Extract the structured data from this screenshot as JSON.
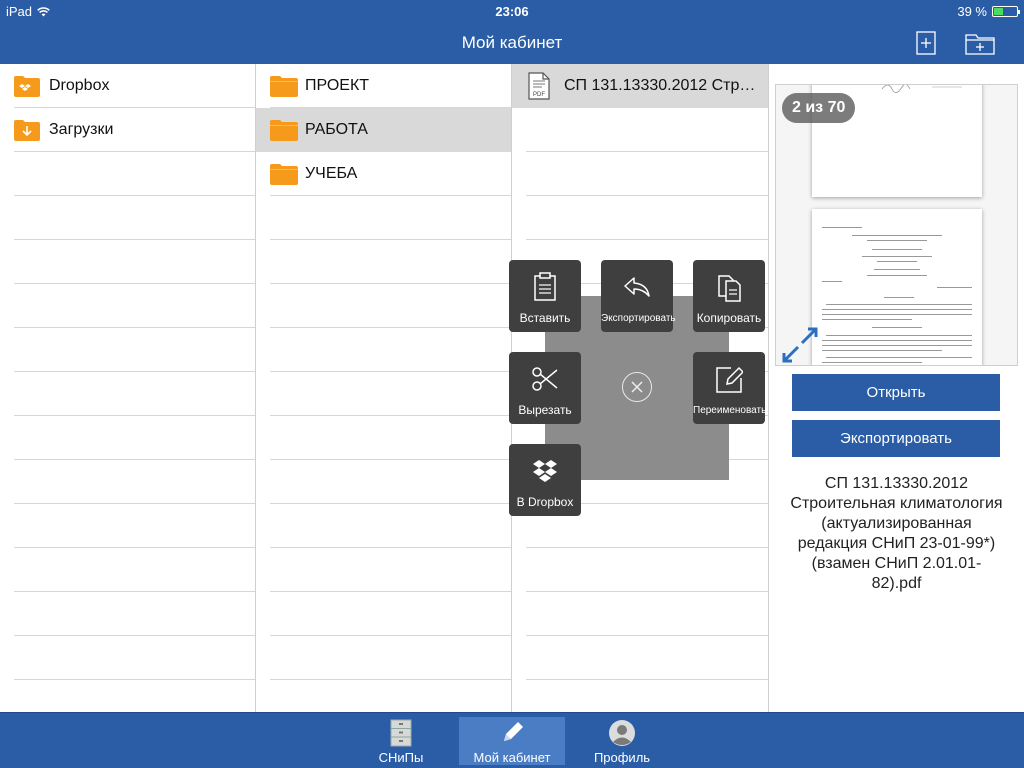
{
  "status_bar": {
    "carrier": "iPad",
    "time": "23:06",
    "battery": "39 %",
    "battery_level": 0.39
  },
  "nav": {
    "title": "Мой кабинет",
    "icons": [
      "add-icon",
      "new-folder-icon"
    ]
  },
  "column1": {
    "items": [
      {
        "label": "Dropbox",
        "icon": "dropbox-folder-icon"
      },
      {
        "label": "Загрузки",
        "icon": "download-folder-icon"
      }
    ]
  },
  "column2": {
    "items": [
      {
        "label": "ПРОЕКТ",
        "icon": "folder-icon"
      },
      {
        "label": "РАБОТА",
        "icon": "folder-icon",
        "selected": true
      },
      {
        "label": "УЧЕБА",
        "icon": "folder-icon"
      }
    ]
  },
  "column3": {
    "items": [
      {
        "label": "СП 131.13330.2012 Стр…",
        "icon": "pdf-file-icon",
        "icon_text": "PDF",
        "selected": true
      }
    ]
  },
  "context_menu": {
    "paste": "Вставить",
    "export": "Экспортировать",
    "copy": "Копировать",
    "cut": "Вырезать",
    "rename": "Переименовать",
    "dropbox": "В Dropbox"
  },
  "preview": {
    "page_indicator": "2 из 70",
    "open_button": "Открыть",
    "export_button": "Экспортировать",
    "file_name": "СП 131.13330.2012 Строительная климатология (актуализированная редакция СНиП 23-01-99*) (взамен СНиП 2.01.01-82).pdf"
  },
  "tabs": [
    {
      "label": "СНиПы",
      "icon": "cabinet-icon"
    },
    {
      "label": "Мой кабинет",
      "icon": "pencil-icon",
      "active": true
    },
    {
      "label": "Профиль",
      "icon": "profile-icon"
    }
  ],
  "colors": {
    "brand_blue": "#2b5da6",
    "folder_orange": "#f59a1b",
    "menu_tile": "#3f3f3f",
    "selected_row": "#d9d9d9"
  }
}
